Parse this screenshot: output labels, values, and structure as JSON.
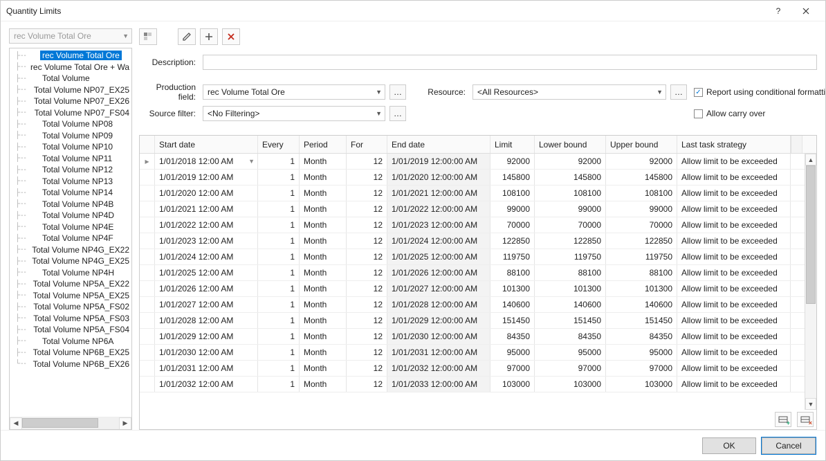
{
  "window": {
    "title": "Quantity Limits"
  },
  "combo_disabled": "rec Volume Total Ore",
  "tree": {
    "items": [
      "rec Volume Total Ore",
      "rec Volume Total Ore + Wa",
      "Total Volume",
      "Total Volume NP07_EX25",
      "Total Volume NP07_EX26",
      "Total Volume NP07_FS04",
      "Total Volume NP08",
      "Total Volume NP09",
      "Total Volume NP10",
      "Total Volume NP11",
      "Total Volume NP12",
      "Total Volume NP13",
      "Total Volume NP14",
      "Total Volume NP4B",
      "Total Volume NP4D",
      "Total Volume NP4E",
      "Total Volume NP4F",
      "Total Volume NP4G_EX22",
      "Total Volume NP4G_EX25",
      "Total Volume NP4H",
      "Total Volume NP5A_EX22",
      "Total Volume NP5A_EX25",
      "Total Volume NP5A_FS02",
      "Total Volume NP5A_FS03",
      "Total Volume NP5A_FS04",
      "Total Volume NP6A",
      "Total Volume NP6B_EX25",
      "Total Volume NP6B_EX26"
    ],
    "selected": 0
  },
  "fields": {
    "description_label": "Description:",
    "description_value": "",
    "production_label": "Production field:",
    "production_value": "rec Volume Total Ore",
    "resource_label": "Resource:",
    "resource_value": "<All Resources>",
    "source_label": "Source filter:",
    "source_value": "<No Filtering>",
    "report_label": "Report using conditional formatting",
    "report_checked": true,
    "carry_label": "Allow carry over",
    "carry_checked": false
  },
  "gridHeaders": {
    "start": "Start date",
    "every": "Every",
    "period": "Period",
    "for": "For",
    "end": "End date",
    "limit": "Limit",
    "lower": "Lower bound",
    "upper": "Upper bound",
    "strat": "Last task strategy"
  },
  "rows": [
    {
      "start": "1/01/2018 12:00 AM",
      "every": 1,
      "period": "Month",
      "for": 12,
      "end": "1/01/2019 12:00:00 AM",
      "limit": 92000,
      "lower": 92000,
      "upper": 92000,
      "strat": "Allow limit to be exceeded",
      "indicator": true
    },
    {
      "start": "1/01/2019 12:00 AM",
      "every": 1,
      "period": "Month",
      "for": 12,
      "end": "1/01/2020 12:00:00 AM",
      "limit": 145800,
      "lower": 145800,
      "upper": 145800,
      "strat": "Allow limit to be exceeded"
    },
    {
      "start": "1/01/2020 12:00 AM",
      "every": 1,
      "period": "Month",
      "for": 12,
      "end": "1/01/2021 12:00:00 AM",
      "limit": 108100,
      "lower": 108100,
      "upper": 108100,
      "strat": "Allow limit to be exceeded"
    },
    {
      "start": "1/01/2021 12:00 AM",
      "every": 1,
      "period": "Month",
      "for": 12,
      "end": "1/01/2022 12:00:00 AM",
      "limit": 99000,
      "lower": 99000,
      "upper": 99000,
      "strat": "Allow limit to be exceeded"
    },
    {
      "start": "1/01/2022 12:00 AM",
      "every": 1,
      "period": "Month",
      "for": 12,
      "end": "1/01/2023 12:00:00 AM",
      "limit": 70000,
      "lower": 70000,
      "upper": 70000,
      "strat": "Allow limit to be exceeded"
    },
    {
      "start": "1/01/2023 12:00 AM",
      "every": 1,
      "period": "Month",
      "for": 12,
      "end": "1/01/2024 12:00:00 AM",
      "limit": 122850,
      "lower": 122850,
      "upper": 122850,
      "strat": "Allow limit to be exceeded"
    },
    {
      "start": "1/01/2024 12:00 AM",
      "every": 1,
      "period": "Month",
      "for": 12,
      "end": "1/01/2025 12:00:00 AM",
      "limit": 119750,
      "lower": 119750,
      "upper": 119750,
      "strat": "Allow limit to be exceeded"
    },
    {
      "start": "1/01/2025 12:00 AM",
      "every": 1,
      "period": "Month",
      "for": 12,
      "end": "1/01/2026 12:00:00 AM",
      "limit": 88100,
      "lower": 88100,
      "upper": 88100,
      "strat": "Allow limit to be exceeded"
    },
    {
      "start": "1/01/2026 12:00 AM",
      "every": 1,
      "period": "Month",
      "for": 12,
      "end": "1/01/2027 12:00:00 AM",
      "limit": 101300,
      "lower": 101300,
      "upper": 101300,
      "strat": "Allow limit to be exceeded"
    },
    {
      "start": "1/01/2027 12:00 AM",
      "every": 1,
      "period": "Month",
      "for": 12,
      "end": "1/01/2028 12:00:00 AM",
      "limit": 140600,
      "lower": 140600,
      "upper": 140600,
      "strat": "Allow limit to be exceeded"
    },
    {
      "start": "1/01/2028 12:00 AM",
      "every": 1,
      "period": "Month",
      "for": 12,
      "end": "1/01/2029 12:00:00 AM",
      "limit": 151450,
      "lower": 151450,
      "upper": 151450,
      "strat": "Allow limit to be exceeded"
    },
    {
      "start": "1/01/2029 12:00 AM",
      "every": 1,
      "period": "Month",
      "for": 12,
      "end": "1/01/2030 12:00:00 AM",
      "limit": 84350,
      "lower": 84350,
      "upper": 84350,
      "strat": "Allow limit to be exceeded"
    },
    {
      "start": "1/01/2030 12:00 AM",
      "every": 1,
      "period": "Month",
      "for": 12,
      "end": "1/01/2031 12:00:00 AM",
      "limit": 95000,
      "lower": 95000,
      "upper": 95000,
      "strat": "Allow limit to be exceeded"
    },
    {
      "start": "1/01/2031 12:00 AM",
      "every": 1,
      "period": "Month",
      "for": 12,
      "end": "1/01/2032 12:00:00 AM",
      "limit": 97000,
      "lower": 97000,
      "upper": 97000,
      "strat": "Allow limit to be exceeded"
    },
    {
      "start": "1/01/2032 12:00 AM",
      "every": 1,
      "period": "Month",
      "for": 12,
      "end": "1/01/2033 12:00:00 AM",
      "limit": 103000,
      "lower": 103000,
      "upper": 103000,
      "strat": "Allow limit to be exceeded"
    }
  ],
  "footer": {
    "ok": "OK",
    "cancel": "Cancel"
  }
}
